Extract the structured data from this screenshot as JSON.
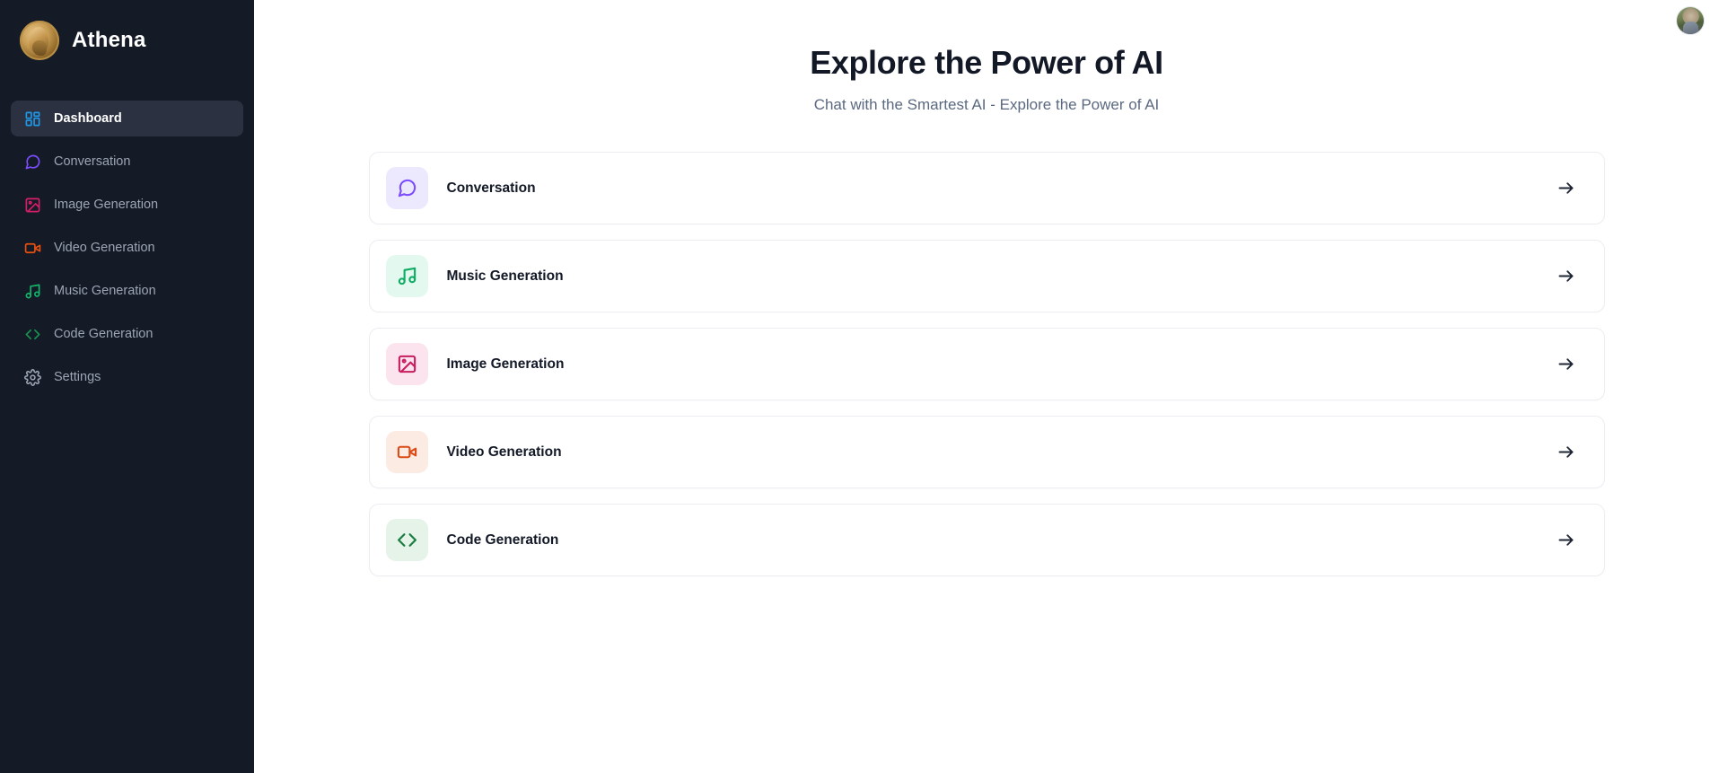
{
  "sidebar": {
    "brand": {
      "name": "Athena",
      "logo_icon": "athena-helmet-logo"
    },
    "items": [
      {
        "label": "Dashboard",
        "icon": "layout-grid-icon",
        "color": "#1f97e8",
        "active": true
      },
      {
        "label": "Conversation",
        "icon": "message-square-icon",
        "color": "#7c4dff",
        "active": false
      },
      {
        "label": "Image Generation",
        "icon": "image-icon",
        "color": "#d61f69",
        "active": false
      },
      {
        "label": "Video Generation",
        "icon": "video-camera-icon",
        "color": "#e8500f",
        "active": false
      },
      {
        "label": "Music Generation",
        "icon": "music-note-icon",
        "color": "#12b76a",
        "active": false
      },
      {
        "label": "Code Generation",
        "icon": "code-brackets-icon",
        "color": "#179150",
        "active": false
      },
      {
        "label": "Settings",
        "icon": "gear-icon",
        "color": "#9ca5b4",
        "active": false
      }
    ]
  },
  "header": {
    "title": "Explore the Power of AI",
    "subtitle": "Chat with the Smartest AI - Explore the Power of AI",
    "avatar_icon": "user-avatar-photo"
  },
  "cards": [
    {
      "label": "Conversation",
      "icon": "message-square-icon",
      "icon_color": "#7c4dff",
      "icon_bg": "#ece8fe",
      "arrow_icon": "arrow-right-icon"
    },
    {
      "label": "Music Generation",
      "icon": "music-note-icon",
      "icon_color": "#0eab63",
      "icon_bg": "#e3f8ee",
      "arrow_icon": "arrow-right-icon"
    },
    {
      "label": "Image Generation",
      "icon": "image-icon",
      "icon_color": "#c81e5f",
      "icon_bg": "#fbe4ee",
      "arrow_icon": "arrow-right-icon"
    },
    {
      "label": "Video Generation",
      "icon": "video-camera-icon",
      "icon_color": "#dc4a16",
      "icon_bg": "#fcebe3",
      "arrow_icon": "arrow-right-icon"
    },
    {
      "label": "Code Generation",
      "icon": "code-brackets-icon",
      "icon_color": "#1a7f42",
      "icon_bg": "#e6f3e9",
      "arrow_icon": "arrow-right-icon"
    }
  ],
  "theme": {
    "sidebar_bg": "#141a26",
    "sidebar_active_bg": "#2b3140",
    "text_dark": "#121826",
    "text_muted": "#5b6980",
    "card_border": "#ececf1"
  }
}
